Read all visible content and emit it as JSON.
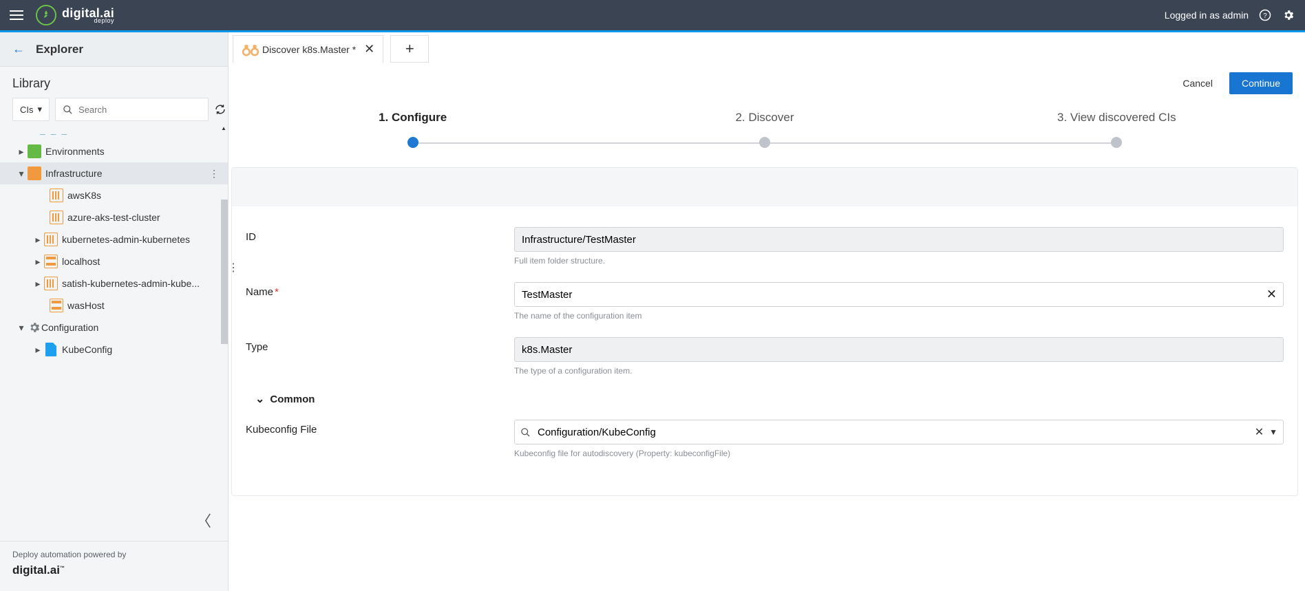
{
  "appbar": {
    "brand_main": "digital.ai",
    "brand_sub": "deploy",
    "login_text": "Logged in as admin"
  },
  "sidebar": {
    "title": "Explorer",
    "library_title": "Library",
    "filter_label": "CIs",
    "search_placeholder": "Search",
    "nodes": {
      "environments": "Environments",
      "infrastructure": "Infrastructure",
      "awsK8s": "awsK8s",
      "azure_aks": "azure-aks-test-cluster",
      "kube_admin": "kubernetes-admin-kubernetes",
      "localhost": "localhost",
      "satish": "satish-kubernetes-admin-kube...",
      "wasHost": "wasHost",
      "configuration": "Configuration",
      "kubeconfig": "KubeConfig"
    },
    "footer_line": "Deploy automation powered by",
    "footer_brand": "digital.ai"
  },
  "tab": {
    "title": "Discover k8s.Master *"
  },
  "actions": {
    "cancel": "Cancel",
    "continue": "Continue"
  },
  "steps": {
    "s1": "1. Configure",
    "s2": "2. Discover",
    "s3": "3. View discovered CIs"
  },
  "form": {
    "id_label": "ID",
    "id_value": "Infrastructure/TestMaster",
    "id_help": "Full item folder structure.",
    "name_label": "Name",
    "name_value": "TestMaster",
    "name_help": "The name of the configuration item",
    "type_label": "Type",
    "type_value": "k8s.Master",
    "type_help": "The type of a configuration item.",
    "common_label": "Common",
    "kube_label": "Kubeconfig File",
    "kube_value": "Configuration/KubeConfig",
    "kube_help": "Kubeconfig file for autodiscovery (Property: kubeconfigFile)"
  }
}
